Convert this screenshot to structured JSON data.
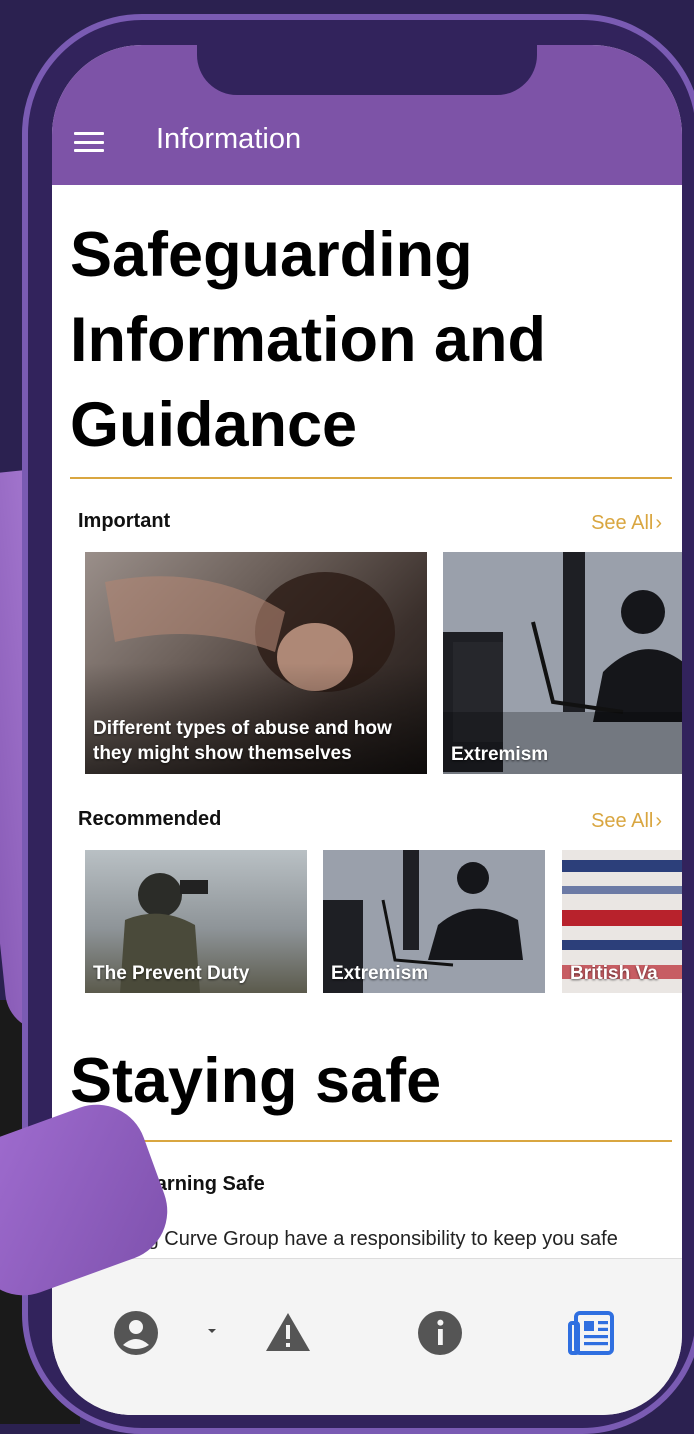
{
  "app_bar": {
    "title": "Information"
  },
  "page": {
    "title": "Safeguarding Information and Guidance"
  },
  "important": {
    "label": "Important",
    "see_all": "See All",
    "cards": [
      {
        "title": "Different types of abuse and how they might show themselves"
      },
      {
        "title": "Extremism"
      }
    ]
  },
  "recommended": {
    "label": "Recommended",
    "see_all": "See All",
    "cards": [
      {
        "title": "The Prevent Duty"
      },
      {
        "title": "Extremism"
      },
      {
        "title": "British Va"
      }
    ]
  },
  "staying_safe": {
    "title": "Staying safe",
    "subtitle": "Keep Learning Safe",
    "body": "earning Curve Group have a responsibility to keep you safe\nd to be able to offer support and guidance across a wide"
  },
  "bottom_nav": {
    "items": [
      {
        "icon": "account-circle-icon"
      },
      {
        "icon": "warning-icon"
      },
      {
        "icon": "info-icon"
      },
      {
        "icon": "newspaper-icon",
        "active": true
      }
    ]
  },
  "colors": {
    "primary": "#7d53a7",
    "accent": "#d9a640",
    "active_nav": "#2f6fe0"
  }
}
